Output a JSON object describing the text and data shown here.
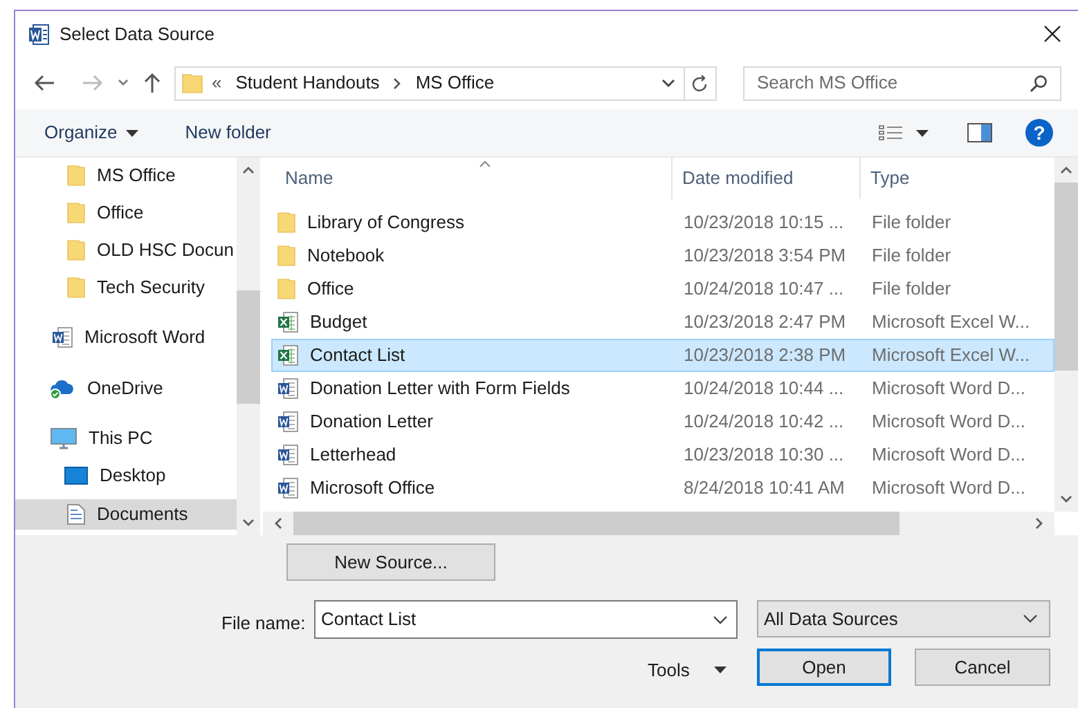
{
  "window": {
    "title": "Select Data Source"
  },
  "address_bar": {
    "overflow": "«",
    "path": [
      "Student Handouts",
      "MS Office"
    ]
  },
  "search": {
    "placeholder": "Search MS Office"
  },
  "toolbar": {
    "organize": "Organize",
    "new_folder": "New folder",
    "help": "?"
  },
  "sidebar": {
    "items": [
      {
        "label": "MS Office",
        "kind": "folder",
        "selected": false
      },
      {
        "label": "Office",
        "kind": "folder",
        "selected": false
      },
      {
        "label": "OLD HSC Docun",
        "kind": "folder",
        "selected": false
      },
      {
        "label": "Tech Security",
        "kind": "folder",
        "selected": false
      },
      {
        "label": "Microsoft Word",
        "kind": "word",
        "selected": false
      },
      {
        "label": "OneDrive",
        "kind": "cloud",
        "selected": false
      },
      {
        "label": "This PC",
        "kind": "computer",
        "selected": false
      },
      {
        "label": "Desktop",
        "kind": "desktop",
        "selected": false
      },
      {
        "label": "Documents",
        "kind": "documents",
        "selected": true
      }
    ]
  },
  "table": {
    "columns": [
      "Name",
      "Date modified",
      "Type"
    ],
    "rows": [
      {
        "name": "Library of Congress",
        "date": "10/23/2018 10:15 ...",
        "type": "File folder",
        "kind": "folder",
        "selected": false
      },
      {
        "name": "Notebook",
        "date": "10/23/2018 3:54 PM",
        "type": "File folder",
        "kind": "folder",
        "selected": false
      },
      {
        "name": "Office",
        "date": "10/24/2018 10:47 ...",
        "type": "File folder",
        "kind": "folder",
        "selected": false
      },
      {
        "name": "Budget",
        "date": "10/23/2018 2:47 PM",
        "type": "Microsoft Excel W...",
        "kind": "excel",
        "selected": false
      },
      {
        "name": "Contact List",
        "date": "10/23/2018 2:38 PM",
        "type": "Microsoft Excel W...",
        "kind": "excel",
        "selected": true
      },
      {
        "name": "Donation Letter with Form Fields",
        "date": "10/24/2018 10:44 ...",
        "type": "Microsoft Word D...",
        "kind": "word",
        "selected": false
      },
      {
        "name": "Donation Letter",
        "date": "10/24/2018 10:42 ...",
        "type": "Microsoft Word D...",
        "kind": "word",
        "selected": false
      },
      {
        "name": "Letterhead",
        "date": "10/23/2018 10:30 ...",
        "type": "Microsoft Word D...",
        "kind": "word",
        "selected": false
      },
      {
        "name": "Microsoft Office",
        "date": "8/24/2018 10:41 AM",
        "type": "Microsoft Word D...",
        "kind": "word",
        "selected": false
      }
    ]
  },
  "new_source_button": "New Source...",
  "file_name": {
    "label": "File name:",
    "value": "Contact List"
  },
  "filter": {
    "value": "All Data Sources"
  },
  "tools": "Tools",
  "open_button": "Open",
  "cancel_button": "Cancel"
}
